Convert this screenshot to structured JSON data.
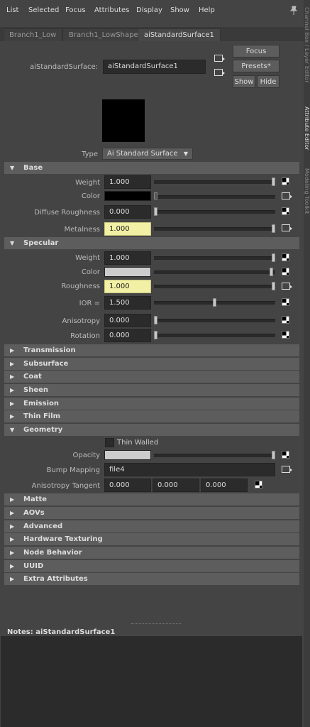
{
  "menu": [
    "List",
    "Selected",
    "Focus",
    "Attributes",
    "Display",
    "Show",
    "Help"
  ],
  "tabs": [
    "Branch1_Low",
    "Branch1_LowShape",
    "aiStandardSurface1"
  ],
  "node": {
    "label": "aiStandardSurface:",
    "value": "aiStandardSurface1"
  },
  "buttons": {
    "focus": "Focus",
    "presets": "Presets*",
    "show": "Show",
    "hide": "Hide"
  },
  "type": {
    "label": "Type",
    "value": "Ai Standard Surface"
  },
  "sections": {
    "base": "Base",
    "specular": "Specular",
    "transmission": "Transmission",
    "subsurface": "Subsurface",
    "coat": "Coat",
    "sheen": "Sheen",
    "emission": "Emission",
    "thin_film": "Thin Film",
    "geometry": "Geometry",
    "matte": "Matte",
    "aovs": "AOVs",
    "advanced": "Advanced",
    "hardware_texturing": "Hardware Texturing",
    "node_behavior": "Node Behavior",
    "uuid": "UUID",
    "extra_attributes": "Extra Attributes"
  },
  "base": {
    "weight": {
      "label": "Weight",
      "value": "1.000",
      "level": 1.0
    },
    "color": {
      "label": "Color",
      "color": "#000000"
    },
    "diffuse_roughness": {
      "label": "Diffuse Roughness",
      "value": "0.000",
      "level": 0.0
    },
    "metalness": {
      "label": "Metalness",
      "value": "1.000",
      "level": 1.0
    }
  },
  "specular": {
    "weight": {
      "label": "Weight",
      "value": "1.000",
      "level": 1.0
    },
    "color": {
      "label": "Color",
      "color": "#cccccc"
    },
    "roughness": {
      "label": "Roughness",
      "value": "1.000",
      "level": 1.0
    },
    "ior": {
      "label": "IOR =",
      "value": "1.500",
      "level": 0.5
    },
    "anisotropy": {
      "label": "Anisotropy",
      "value": "0.000",
      "level": 0.0
    },
    "rotation": {
      "label": "Rotation",
      "value": "0.000",
      "level": 0.0
    }
  },
  "geometry": {
    "thin_walled": {
      "label": "Thin Walled",
      "checked": false
    },
    "opacity": {
      "label": "Opacity",
      "color": "#cccccc",
      "level": 1.0
    },
    "bump_mapping": {
      "label": "Bump Mapping",
      "value": "file4"
    },
    "anisotropy_tangent": {
      "label": "Anisotropy Tangent",
      "values": [
        "0.000",
        "0.000",
        "0.000"
      ]
    }
  },
  "notes": {
    "label": "Notes:",
    "name": "aiStandardSurface1"
  },
  "side_tabs": [
    "Channel Box / Layer Editor",
    "Attribute Editor",
    "Modeling Toolkit"
  ],
  "colors": {
    "panel": "#444444",
    "header": "#5d5d5d",
    "field": "#2b2b2b",
    "highlight": "#f2f0a5"
  }
}
